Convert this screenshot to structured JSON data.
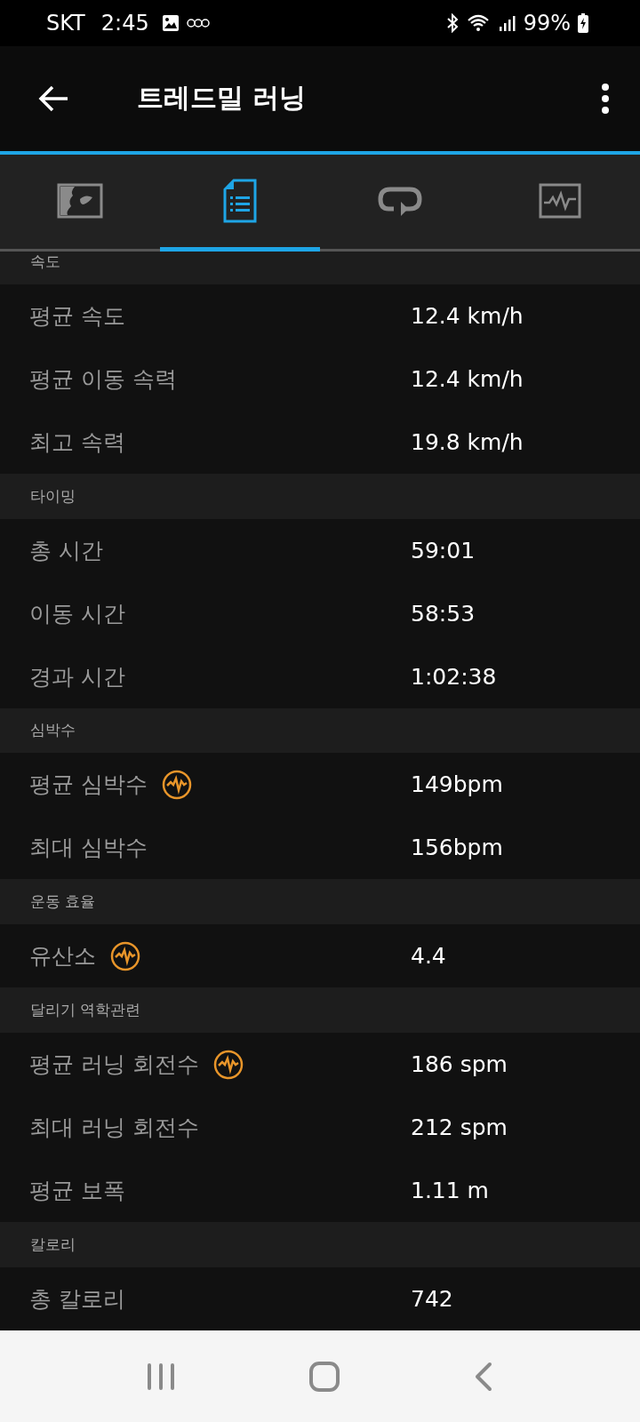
{
  "status_bar": {
    "carrier": "SKT",
    "time": "2:45",
    "battery": "99%"
  },
  "app_bar": {
    "title": "트레드밀 러닝"
  },
  "tabs": [
    {
      "selected": false
    },
    {
      "selected": true
    },
    {
      "selected": false
    },
    {
      "selected": false
    }
  ],
  "sections": [
    {
      "title": "속도",
      "rows": [
        {
          "label": "평균 속도",
          "value": "12.4 km/h",
          "hr_icon": false
        },
        {
          "label": "평균 이동 속력",
          "value": "12.4 km/h",
          "hr_icon": false
        },
        {
          "label": "최고 속력",
          "value": "19.8 km/h",
          "hr_icon": false
        }
      ]
    },
    {
      "title": "타이밍",
      "rows": [
        {
          "label": "총 시간",
          "value": "59:01",
          "hr_icon": false
        },
        {
          "label": "이동 시간",
          "value": "58:53",
          "hr_icon": false
        },
        {
          "label": "경과 시간",
          "value": "1:02:38",
          "hr_icon": false
        }
      ]
    },
    {
      "title": "심박수",
      "rows": [
        {
          "label": "평균 심박수",
          "value": "149bpm",
          "hr_icon": true
        },
        {
          "label": "최대 심박수",
          "value": "156bpm",
          "hr_icon": false
        }
      ]
    },
    {
      "title": "운동 효율",
      "rows": [
        {
          "label": "유산소",
          "value": "4.4",
          "hr_icon": true
        }
      ]
    },
    {
      "title": "달리기 역학관련",
      "rows": [
        {
          "label": "평균 러닝 회전수",
          "value": "186 spm",
          "hr_icon": true
        },
        {
          "label": "최대 러닝 회전수",
          "value": "212 spm",
          "hr_icon": false
        },
        {
          "label": "평균 보폭",
          "value": "1.11 m",
          "hr_icon": false
        }
      ]
    },
    {
      "title": "칼로리",
      "rows": [
        {
          "label": "총 칼로리",
          "value": "742",
          "hr_icon": false
        }
      ]
    }
  ]
}
